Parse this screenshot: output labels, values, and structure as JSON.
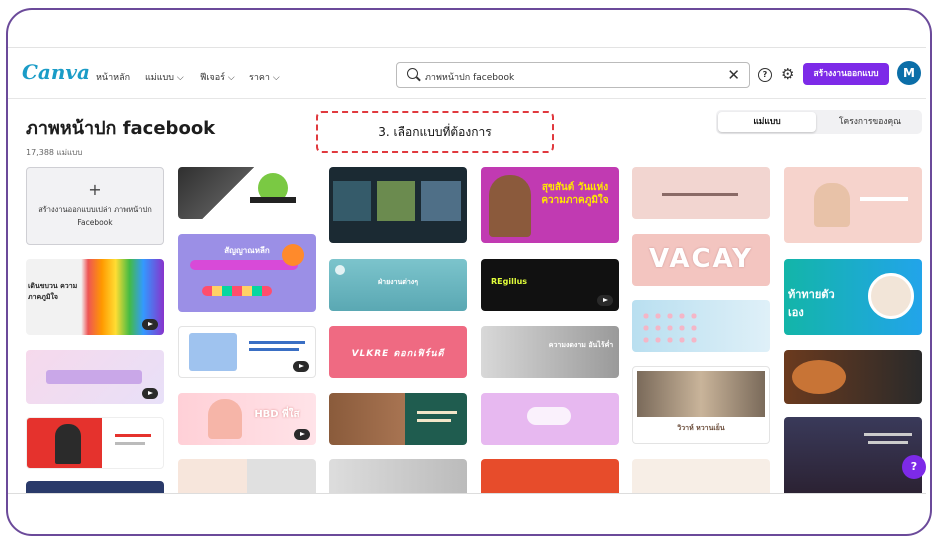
{
  "header": {
    "logo": "Canva",
    "nav": [
      "หน้าหลัก",
      "แม่แบบ ⌵",
      "ฟีเจอร์ ⌵",
      "ราคา ⌵"
    ],
    "search_value": "ภาพหน้าปก facebook",
    "clear": "✕",
    "help": "?",
    "settings": "⚙",
    "create_label": "สร้างงานออกแบบ",
    "avatar": "M"
  },
  "page": {
    "title": "ภาพหน้าปก facebook",
    "count": "17,388 แม่แบบ",
    "tabs": [
      "แม่แบบ",
      "โครงการของคุณ"
    ],
    "callout": "3. เลือกแบบที่ต้องการ",
    "new_design": {
      "plus": "+",
      "label": "สร้างงานออกแบบเปล่า ภาพหน้าปก Facebook"
    }
  },
  "templates": {
    "col2": [
      "สัญญาณหลีก",
      "HBD พี่ใส"
    ],
    "col3": [
      "ฝ่ายงานต่างๆ",
      "VLKRE ดอกเฟิร์นดี"
    ],
    "col4": [
      "สุขสันต์ วันแห่งความภาคภูมิใจ",
      "REgillus",
      "ความงดงาม อันไร้ค่ำ"
    ],
    "col5": [
      "VACAY",
      "วิวาห์ หวานเย็น"
    ],
    "col6": [
      "ท้าทายตัวเอง"
    ],
    "col1": [
      "เดินขบวน ความภาคภูมิใจ"
    ]
  },
  "fab": "?"
}
